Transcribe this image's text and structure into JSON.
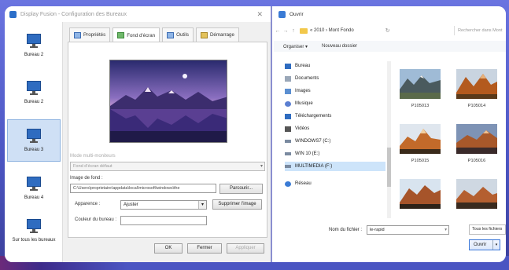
{
  "left_window": {
    "title": "Display Fusion - Configuration des Bureaux",
    "desktops": [
      {
        "label": "Bureau 2"
      },
      {
        "label": "Bureau 2"
      },
      {
        "label": "Bureau 3"
      },
      {
        "label": "Bureau 4"
      },
      {
        "label": "Sur tous les bureaux"
      }
    ],
    "tabs": [
      {
        "label": "Propriétés"
      },
      {
        "label": "Fond d'écran"
      },
      {
        "label": "Outils"
      },
      {
        "label": "Démarrage"
      }
    ],
    "mode_label": "Mode multi-moniteurs",
    "mode_value": "Fond d'écran défaut",
    "image_label": "Image de fond :",
    "image_path": "C:\\Users\\proprietaire\\appdata\\local\\microsoft\\windows\\the",
    "browse_label": "Parcourir...",
    "position_label": "Apparence :",
    "position_value": "Ajuster",
    "remove_image_label": "Supprimer l'image",
    "color_label": "Couleur du bureau :",
    "ok_label": "OK",
    "close_label": "Fermer",
    "apply_label": "Appliquer"
  },
  "right_window": {
    "title": "Ouvrir",
    "breadcrumb": "« 2010 › Mont Fondo",
    "search_placeholder": "Rechercher dans Mont Fondo",
    "organize_label": "Organiser ▾",
    "new_folder_label": "Nouveau dossier",
    "nav_items": [
      {
        "label": "Bureau",
        "icon": "desktop-folder-icon",
        "color": "#2f6cc0"
      },
      {
        "label": "Documents",
        "icon": "documents-icon",
        "color": "#9aa7b8"
      },
      {
        "label": "Images",
        "icon": "pictures-icon",
        "color": "#5b8fd1"
      },
      {
        "label": "Musique",
        "icon": "music-icon",
        "color": "#5b7fd1"
      },
      {
        "label": "Téléchargements",
        "icon": "downloads-icon",
        "color": "#2f6cc0"
      },
      {
        "label": "Vidéos",
        "icon": "videos-icon",
        "color": "#555555"
      },
      {
        "label": "WINDOWS7 (C:)",
        "icon": "drive-icon",
        "color": "#7a8aa0"
      },
      {
        "label": "WIN 10 (E:)",
        "icon": "drive-icon",
        "color": "#7a8aa0"
      },
      {
        "label": "MULTIMEDIA (F:)",
        "icon": "drive-icon",
        "color": "#7a8aa0"
      },
      {
        "label": "Réseau",
        "icon": "network-icon",
        "color": "#3a7bd5"
      }
    ],
    "thumbnails": [
      {
        "label": "P105013"
      },
      {
        "label": "P105014"
      },
      {
        "label": "P105015"
      },
      {
        "label": "P105016"
      },
      {
        "label": ""
      },
      {
        "label": ""
      }
    ],
    "filename_label": "Nom du fichier :",
    "filename_value": "le-rapid",
    "filter_value": "Tous les fichiers",
    "open_label": "Ouvrir"
  }
}
